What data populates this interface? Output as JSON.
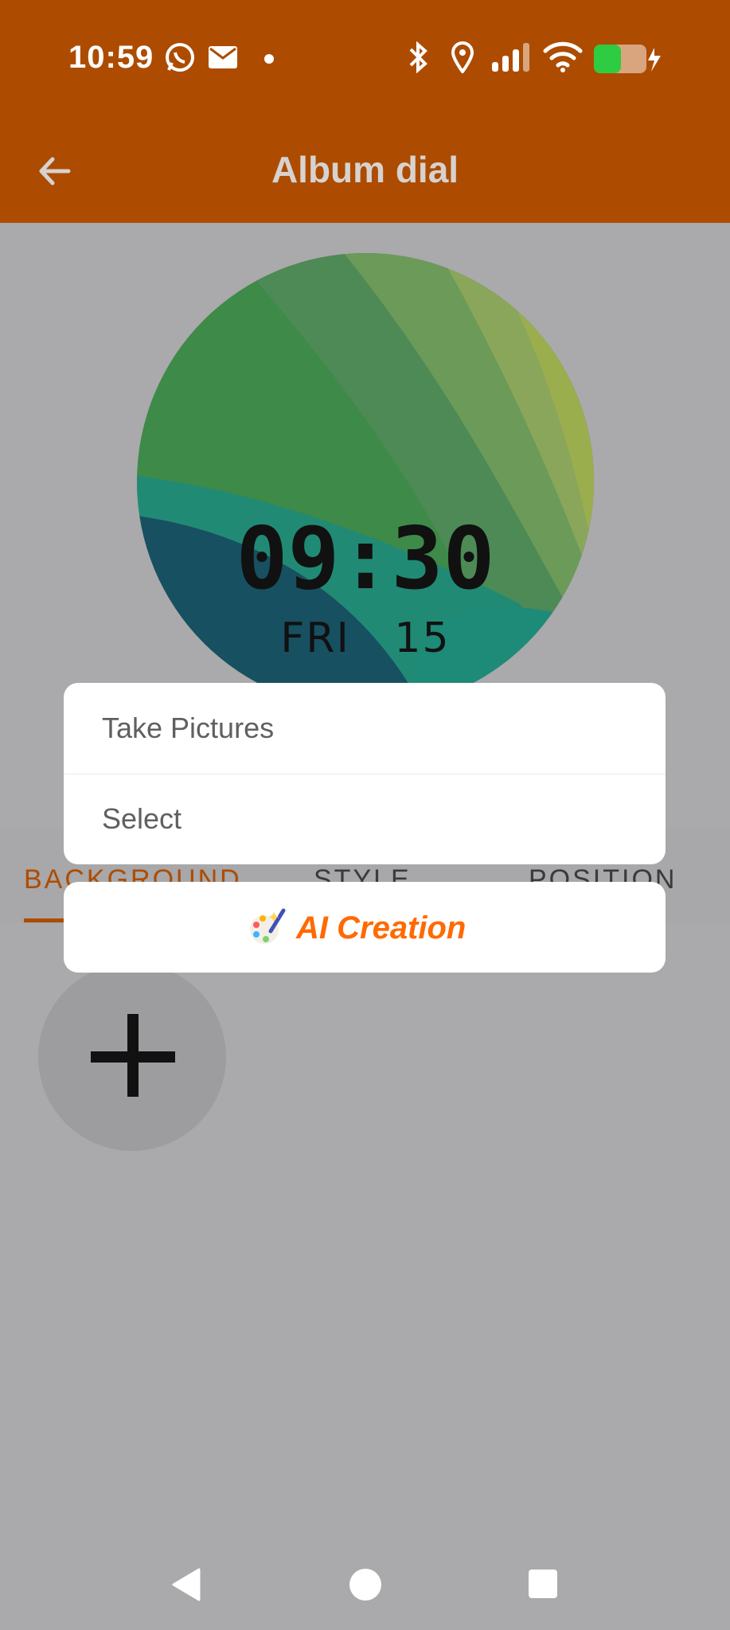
{
  "status_bar": {
    "time": "10:59",
    "icons": [
      "whatsapp-icon",
      "mail-icon",
      "dot-icon",
      "bluetooth-icon",
      "location-icon",
      "signal-icon",
      "wifi-icon",
      "battery-charging-icon"
    ]
  },
  "app_bar": {
    "title": "Album dial",
    "back_icon": "back-arrow-icon"
  },
  "dial": {
    "time": "09:30",
    "day": "FRI",
    "date": "15"
  },
  "tabs": [
    "BACKGROUND",
    "STYLE",
    "POSITION"
  ],
  "add_button_icon": "plus-icon",
  "popup": {
    "items": [
      "Take Pictures",
      "Select"
    ],
    "ai_label": "AI Creation",
    "ai_icon": "ai-palette-icon"
  },
  "nav": [
    "back-triangle-icon",
    "home-circle-icon",
    "recents-square-icon"
  ],
  "colors": {
    "accent": "#ad4c00",
    "overlay_bg": "#aaa9ab",
    "ai_orange": "#ff6a00"
  }
}
